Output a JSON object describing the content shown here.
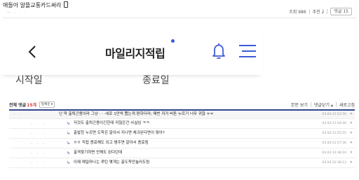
{
  "post": {
    "title": "애들아 알뜰교통카드써라",
    "meta_left": "ㅡ · · ·",
    "views_label": "조회 986",
    "recommend_label": "추천 2",
    "reply_button": "댓글 15"
  },
  "app": {
    "logo_text": "마일리지적립",
    "tab_start": "시작일",
    "tab_end": "종료일",
    "colors": {
      "logo_dot": "#3d5bd9",
      "icon_blue": "#3d5bd9"
    }
  },
  "comments_bar": {
    "title": "전체 댓글",
    "count": "15개",
    "sort": "등록순 ▾",
    "view_main": "본문 보기",
    "collapse": "댓글닫기 ▴",
    "refresh": "새로고침"
  },
  "comments": [
    {
      "author": "· · ·",
      "text": "난 막 출퇴근용이라 그냥 · · ·네로 1만씩 뽑는게 편하더라; 매번 저거 버튼 누르기 너무 귀찮 ㅠㅠ",
      "time": "03.04 21:53:50",
      "reply": false
    },
    {
      "author": "· · ·",
      "text": "저것도 출퇴근용이긴한데 귀찮은건 사실임 ㅋㅋ",
      "time": "03.04 21:54:46",
      "reply": true
    },
    {
      "author": "· · ·",
      "text": "출발한 누르면 도착은 알아서 지나면 체크된다면이 맞아?",
      "time": "03.04 21:55:55",
      "reply": true
    },
    {
      "author": "· · ·",
      "text": "ㅇㅇ 직접 종료해도 되고 범주면 알아서 종료됨",
      "time": "03.04 21:57:36",
      "reply": true
    },
    {
      "author": "· · ·",
      "text": "출격찾기하면 안해도 된다던데",
      "time": "03.04 22:38:24",
      "reply": true
    },
    {
      "author": "· · ·",
      "text": "이제 매일마나는 루틴 몇개는 출도착안눌러도됨",
      "time": "03.04 22:38:12",
      "reply": true
    }
  ]
}
